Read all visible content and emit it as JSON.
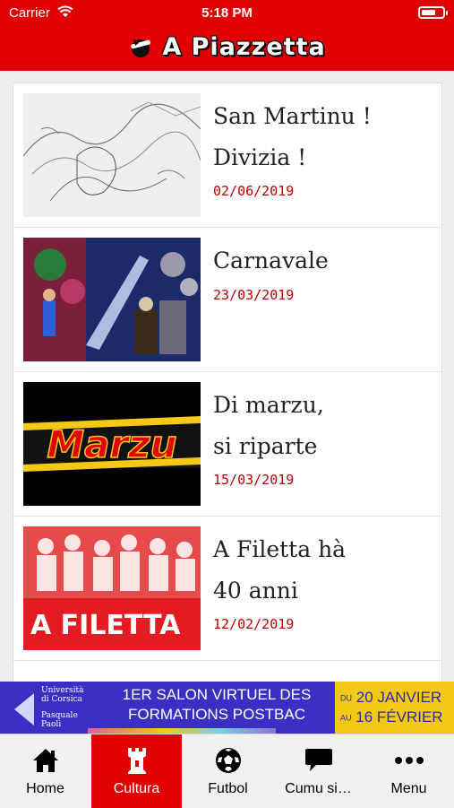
{
  "status_bar": {
    "carrier": "Carrier",
    "time": "5:18 PM",
    "battery_level": 0.7
  },
  "header": {
    "title": "A Piazzetta"
  },
  "articles": [
    {
      "title_line1": "San Martinu !",
      "title_line2": "Divizia !",
      "date": "02/06/2019",
      "image": "pencil-sketch-landscape"
    },
    {
      "title_line1": "Carnavale",
      "title_line2": "",
      "date": "23/03/2019",
      "image": "carnival-painting"
    },
    {
      "title_line1": "Di marzu,",
      "title_line2": "si riparte",
      "date": "15/03/2019",
      "image": "marzu-logo"
    },
    {
      "title_line1": "A Filetta hà",
      "title_line2": "40 anni",
      "date": "12/02/2019",
      "image": "a-filetta-poster"
    }
  ],
  "thumb_texts": {
    "marzu": "Marzu",
    "filetta": "A FILETTA"
  },
  "banner": {
    "logo_line1": "Università",
    "logo_line2": "di Corsica",
    "logo_line3": "Pasquale",
    "logo_line4": "Paoli",
    "line1": "1ER SALON VIRTUEL DES",
    "line2": "FORMATIONS POSTBAC",
    "date1_prefix": "DU",
    "date1": "20 JANVIER",
    "date2_prefix": "AU",
    "date2": "16 FÉVRIER"
  },
  "tabs": [
    {
      "label": "Home",
      "icon": "home-icon"
    },
    {
      "label": "Cultura",
      "icon": "tower-icon"
    },
    {
      "label": "Futbol",
      "icon": "soccer-ball-icon"
    },
    {
      "label": "Cumu si…",
      "icon": "chat-bubble-icon"
    },
    {
      "label": "Menu",
      "icon": "more-dots-icon"
    }
  ],
  "colors": {
    "brand_red": "#e00000",
    "date_red": "#c00000",
    "banner_blue": "#3b2ec2",
    "banner_yellow": "#f4c817"
  }
}
